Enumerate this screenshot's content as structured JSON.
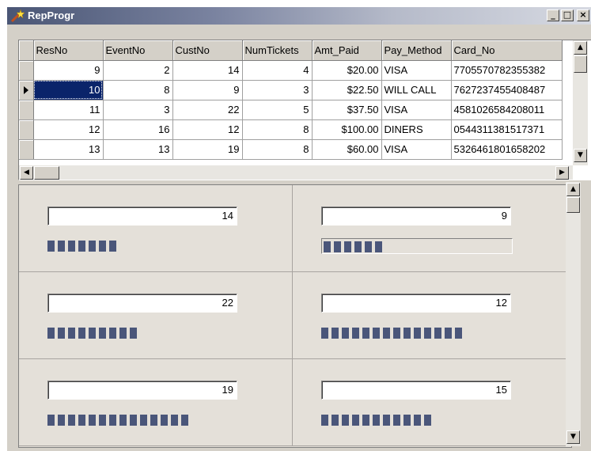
{
  "window": {
    "title": "RepProgr",
    "minimize_label": "_",
    "maximize_label": "□",
    "close_label": "×"
  },
  "grid": {
    "columns": [
      "ResNo",
      "EventNo",
      "CustNo",
      "NumTickets",
      "Amt_Paid",
      "Pay_Method",
      "Card_No"
    ],
    "rows": [
      {
        "ResNo": "9",
        "EventNo": "2",
        "CustNo": "14",
        "NumTickets": "4",
        "Amt_Paid": "$20.00",
        "Pay_Method": "VISA",
        "Card_No": "7705570782355382"
      },
      {
        "ResNo": "10",
        "EventNo": "8",
        "CustNo": "9",
        "NumTickets": "3",
        "Amt_Paid": "$22.50",
        "Pay_Method": "WILL CALL",
        "Card_No": "7627237455408487"
      },
      {
        "ResNo": "11",
        "EventNo": "3",
        "CustNo": "22",
        "NumTickets": "5",
        "Amt_Paid": "$37.50",
        "Pay_Method": "VISA",
        "Card_No": "4581026584208011"
      },
      {
        "ResNo": "12",
        "EventNo": "16",
        "CustNo": "12",
        "NumTickets": "8",
        "Amt_Paid": "$100.00",
        "Pay_Method": "DINERS",
        "Card_No": "0544311381517371"
      },
      {
        "ResNo": "13",
        "EventNo": "13",
        "CustNo": "19",
        "NumTickets": "8",
        "Amt_Paid": "$60.00",
        "Pay_Method": "VISA",
        "Card_No": "5326461801658202"
      }
    ],
    "current_row_index": 1,
    "selected_cell": "ResNo"
  },
  "panels": [
    {
      "value": "14",
      "bar_segments": 7,
      "framed": false
    },
    {
      "value": "9",
      "bar_segments": 6,
      "framed": true
    },
    {
      "value": "22",
      "bar_segments": 9,
      "framed": false
    },
    {
      "value": "12",
      "bar_segments": 14,
      "framed": false
    },
    {
      "value": "19",
      "bar_segments": 14,
      "framed": false
    },
    {
      "value": "15",
      "bar_segments": 11,
      "framed": false
    }
  ],
  "colors": {
    "title_start": "#4a5675",
    "selection": "#0a246a",
    "bar_segment": "#4a567a",
    "face": "#d4d0c8"
  },
  "icons": {
    "app": "wand-icon",
    "scroll_up": "arrow-up-icon",
    "scroll_down": "arrow-down-icon",
    "scroll_left": "arrow-left-icon",
    "scroll_right": "arrow-right-icon"
  }
}
